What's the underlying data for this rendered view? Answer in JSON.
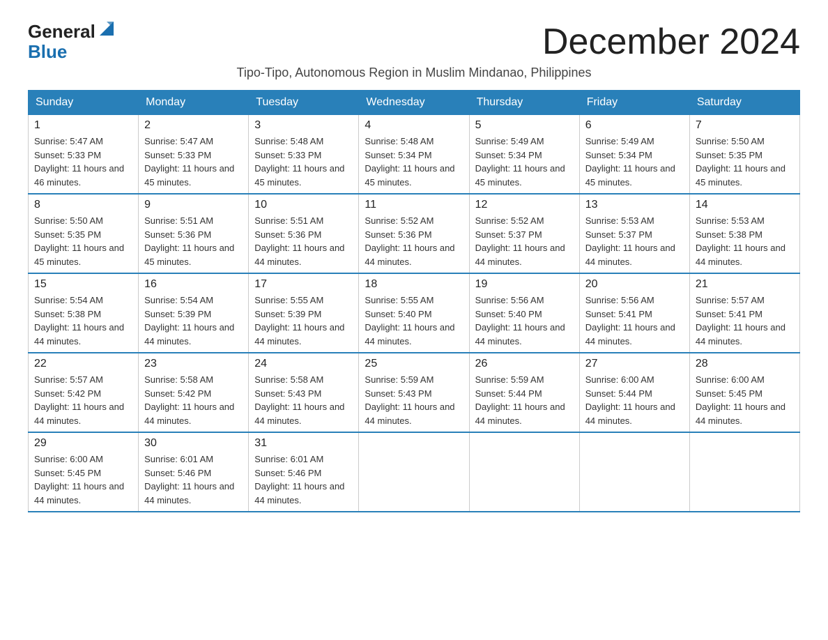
{
  "logo": {
    "text_general": "General",
    "text_blue": "Blue",
    "icon_shape": "triangle"
  },
  "title": "December 2024",
  "subtitle": "Tipo-Tipo, Autonomous Region in Muslim Mindanao, Philippines",
  "calendar": {
    "headers": [
      "Sunday",
      "Monday",
      "Tuesday",
      "Wednesday",
      "Thursday",
      "Friday",
      "Saturday"
    ],
    "weeks": [
      [
        {
          "day": "1",
          "sunrise": "5:47 AM",
          "sunset": "5:33 PM",
          "daylight": "11 hours and 46 minutes."
        },
        {
          "day": "2",
          "sunrise": "5:47 AM",
          "sunset": "5:33 PM",
          "daylight": "11 hours and 45 minutes."
        },
        {
          "day": "3",
          "sunrise": "5:48 AM",
          "sunset": "5:33 PM",
          "daylight": "11 hours and 45 minutes."
        },
        {
          "day": "4",
          "sunrise": "5:48 AM",
          "sunset": "5:34 PM",
          "daylight": "11 hours and 45 minutes."
        },
        {
          "day": "5",
          "sunrise": "5:49 AM",
          "sunset": "5:34 PM",
          "daylight": "11 hours and 45 minutes."
        },
        {
          "day": "6",
          "sunrise": "5:49 AM",
          "sunset": "5:34 PM",
          "daylight": "11 hours and 45 minutes."
        },
        {
          "day": "7",
          "sunrise": "5:50 AM",
          "sunset": "5:35 PM",
          "daylight": "11 hours and 45 minutes."
        }
      ],
      [
        {
          "day": "8",
          "sunrise": "5:50 AM",
          "sunset": "5:35 PM",
          "daylight": "11 hours and 45 minutes."
        },
        {
          "day": "9",
          "sunrise": "5:51 AM",
          "sunset": "5:36 PM",
          "daylight": "11 hours and 45 minutes."
        },
        {
          "day": "10",
          "sunrise": "5:51 AM",
          "sunset": "5:36 PM",
          "daylight": "11 hours and 44 minutes."
        },
        {
          "day": "11",
          "sunrise": "5:52 AM",
          "sunset": "5:36 PM",
          "daylight": "11 hours and 44 minutes."
        },
        {
          "day": "12",
          "sunrise": "5:52 AM",
          "sunset": "5:37 PM",
          "daylight": "11 hours and 44 minutes."
        },
        {
          "day": "13",
          "sunrise": "5:53 AM",
          "sunset": "5:37 PM",
          "daylight": "11 hours and 44 minutes."
        },
        {
          "day": "14",
          "sunrise": "5:53 AM",
          "sunset": "5:38 PM",
          "daylight": "11 hours and 44 minutes."
        }
      ],
      [
        {
          "day": "15",
          "sunrise": "5:54 AM",
          "sunset": "5:38 PM",
          "daylight": "11 hours and 44 minutes."
        },
        {
          "day": "16",
          "sunrise": "5:54 AM",
          "sunset": "5:39 PM",
          "daylight": "11 hours and 44 minutes."
        },
        {
          "day": "17",
          "sunrise": "5:55 AM",
          "sunset": "5:39 PM",
          "daylight": "11 hours and 44 minutes."
        },
        {
          "day": "18",
          "sunrise": "5:55 AM",
          "sunset": "5:40 PM",
          "daylight": "11 hours and 44 minutes."
        },
        {
          "day": "19",
          "sunrise": "5:56 AM",
          "sunset": "5:40 PM",
          "daylight": "11 hours and 44 minutes."
        },
        {
          "day": "20",
          "sunrise": "5:56 AM",
          "sunset": "5:41 PM",
          "daylight": "11 hours and 44 minutes."
        },
        {
          "day": "21",
          "sunrise": "5:57 AM",
          "sunset": "5:41 PM",
          "daylight": "11 hours and 44 minutes."
        }
      ],
      [
        {
          "day": "22",
          "sunrise": "5:57 AM",
          "sunset": "5:42 PM",
          "daylight": "11 hours and 44 minutes."
        },
        {
          "day": "23",
          "sunrise": "5:58 AM",
          "sunset": "5:42 PM",
          "daylight": "11 hours and 44 minutes."
        },
        {
          "day": "24",
          "sunrise": "5:58 AM",
          "sunset": "5:43 PM",
          "daylight": "11 hours and 44 minutes."
        },
        {
          "day": "25",
          "sunrise": "5:59 AM",
          "sunset": "5:43 PM",
          "daylight": "11 hours and 44 minutes."
        },
        {
          "day": "26",
          "sunrise": "5:59 AM",
          "sunset": "5:44 PM",
          "daylight": "11 hours and 44 minutes."
        },
        {
          "day": "27",
          "sunrise": "6:00 AM",
          "sunset": "5:44 PM",
          "daylight": "11 hours and 44 minutes."
        },
        {
          "day": "28",
          "sunrise": "6:00 AM",
          "sunset": "5:45 PM",
          "daylight": "11 hours and 44 minutes."
        }
      ],
      [
        {
          "day": "29",
          "sunrise": "6:00 AM",
          "sunset": "5:45 PM",
          "daylight": "11 hours and 44 minutes."
        },
        {
          "day": "30",
          "sunrise": "6:01 AM",
          "sunset": "5:46 PM",
          "daylight": "11 hours and 44 minutes."
        },
        {
          "day": "31",
          "sunrise": "6:01 AM",
          "sunset": "5:46 PM",
          "daylight": "11 hours and 44 minutes."
        },
        null,
        null,
        null,
        null
      ]
    ]
  }
}
